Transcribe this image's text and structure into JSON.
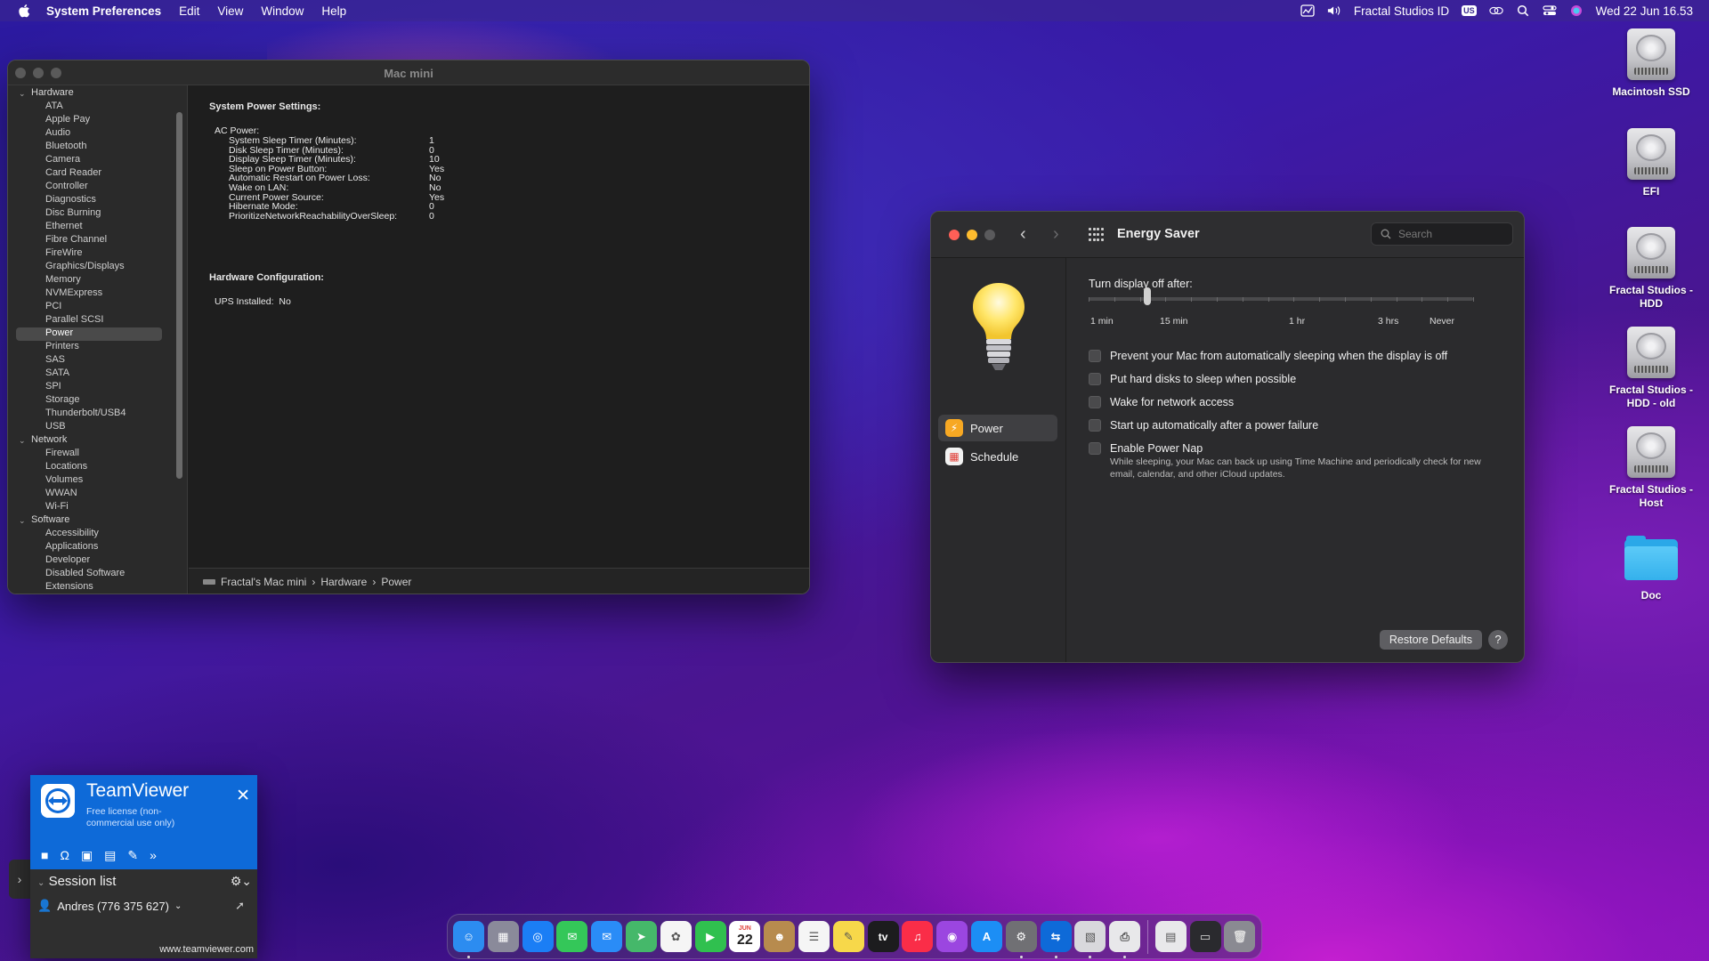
{
  "menubar": {
    "app_name": "System Preferences",
    "menus": [
      "Edit",
      "View",
      "Window",
      "Help"
    ],
    "right": {
      "user": "Fractal Studios ID",
      "keyboard": "US",
      "datetime": "Wed 22 Jun  16.53"
    }
  },
  "system_info": {
    "window_title": "Mac mini",
    "tree": [
      {
        "group": "Hardware",
        "children": [
          "ATA",
          "Apple Pay",
          "Audio",
          "Bluetooth",
          "Camera",
          "Card Reader",
          "Controller",
          "Diagnostics",
          "Disc Burning",
          "Ethernet",
          "Fibre Channel",
          "FireWire",
          "Graphics/Displays",
          "Memory",
          "NVMExpress",
          "PCI",
          "Parallel SCSI",
          "Power",
          "Printers",
          "SAS",
          "SATA",
          "SPI",
          "Storage",
          "Thunderbolt/USB4",
          "USB"
        ]
      },
      {
        "group": "Network",
        "children": [
          "Firewall",
          "Locations",
          "Volumes",
          "WWAN",
          "Wi-Fi"
        ]
      },
      {
        "group": "Software",
        "children": [
          "Accessibility",
          "Applications",
          "Developer",
          "Disabled Software",
          "Extensions"
        ]
      }
    ],
    "selected": "Power",
    "heading": "System Power Settings:",
    "ac_label": "AC Power:",
    "settings": [
      {
        "k": "System Sleep Timer (Minutes):",
        "v": "1"
      },
      {
        "k": "Disk Sleep Timer (Minutes):",
        "v": "0"
      },
      {
        "k": "Display Sleep Timer (Minutes):",
        "v": "10"
      },
      {
        "k": "Sleep on Power Button:",
        "v": "Yes"
      },
      {
        "k": "Automatic Restart on Power Loss:",
        "v": "No"
      },
      {
        "k": "Wake on LAN:",
        "v": "No"
      },
      {
        "k": "Current Power Source:",
        "v": "Yes"
      },
      {
        "k": "Hibernate Mode:",
        "v": "0"
      },
      {
        "k": "PrioritizeNetworkReachabilityOverSleep:",
        "v": "0"
      }
    ],
    "hw_heading": "Hardware Configuration:",
    "ups_label": "UPS Installed:",
    "ups_value": "No",
    "path": [
      "Fractal's Mac mini",
      "Hardware",
      "Power"
    ]
  },
  "energy": {
    "title": "Energy Saver",
    "search_placeholder": "Search",
    "nav": [
      {
        "label": "Power",
        "active": true
      },
      {
        "label": "Schedule",
        "active": false
      }
    ],
    "slider_label": "Turn display off after:",
    "slider_ticks": [
      "1 min",
      "15 min",
      "1 hr",
      "3 hrs",
      "Never"
    ],
    "slider_value": "15 min",
    "options": [
      {
        "label": "Prevent your Mac from automatically sleeping when the display is off",
        "checked": false
      },
      {
        "label": "Put hard disks to sleep when possible",
        "checked": false
      },
      {
        "label": "Wake for network access",
        "checked": false
      },
      {
        "label": "Start up automatically after a power failure",
        "checked": false
      },
      {
        "label": "Enable Power Nap",
        "checked": false
      }
    ],
    "power_nap_note": "While sleeping, your Mac can back up using Time Machine and periodically check for new email, calendar, and other iCloud updates.",
    "restore_label": "Restore Defaults",
    "help_label": "?"
  },
  "desktop_icons": [
    {
      "label": "Macintosh SSD",
      "kind": "disk"
    },
    {
      "label": "EFI",
      "kind": "disk"
    },
    {
      "label": "Fractal Studios - HDD",
      "kind": "disk"
    },
    {
      "label": "Fractal Studios - HDD - old",
      "kind": "disk"
    },
    {
      "label": "Fractal Studios - Host",
      "kind": "disk"
    },
    {
      "label": "Doc",
      "kind": "folder"
    }
  ],
  "teamviewer": {
    "title": "TeamViewer",
    "subtitle": "Free license (non-commercial use only)",
    "session_list": "Session list",
    "user": "Andres (776 375 627)",
    "url": "www.teamviewer.com"
  },
  "dock": {
    "calendar_month": "JUN",
    "calendar_day": "22",
    "tv_label": "tv",
    "apps": [
      {
        "name": "finder",
        "color": "#2c8cf0",
        "running": true
      },
      {
        "name": "launchpad",
        "color": "#8a8a9a",
        "running": false
      },
      {
        "name": "safari",
        "color": "#1b7ef5",
        "running": false
      },
      {
        "name": "messages",
        "color": "#34c759",
        "running": false
      },
      {
        "name": "mail",
        "color": "#2a8cf7",
        "running": false
      },
      {
        "name": "maps",
        "color": "#45b86a",
        "running": false
      },
      {
        "name": "photos",
        "color": "#f5f5f5",
        "running": false
      },
      {
        "name": "facetime",
        "color": "#30c04f",
        "running": false
      },
      {
        "name": "calendar",
        "color": "#ffffff",
        "running": false
      },
      {
        "name": "contacts",
        "color": "#b78b4e",
        "running": false
      },
      {
        "name": "reminders",
        "color": "#f5f5f5",
        "running": false
      },
      {
        "name": "notes",
        "color": "#f7d84a",
        "running": false
      },
      {
        "name": "apple-tv",
        "color": "#1c1c1e",
        "running": false
      },
      {
        "name": "music",
        "color": "#fa2d48",
        "running": false
      },
      {
        "name": "podcasts",
        "color": "#9b46e0",
        "running": false
      },
      {
        "name": "app-store",
        "color": "#1c8ef5",
        "running": false
      },
      {
        "name": "system-preferences",
        "color": "#707074",
        "running": true
      },
      {
        "name": "teamviewer",
        "color": "#0e6ad8",
        "running": true
      },
      {
        "name": "preview",
        "color": "#d8d8dc",
        "running": true
      },
      {
        "name": "printer",
        "color": "#e8e8ea",
        "running": true
      }
    ],
    "trailing": [
      {
        "name": "documents-stack",
        "color": "#e8e8ea"
      },
      {
        "name": "screen-stack",
        "color": "#2a2a2e"
      },
      {
        "name": "trash",
        "color": "#8a8a92"
      }
    ]
  }
}
